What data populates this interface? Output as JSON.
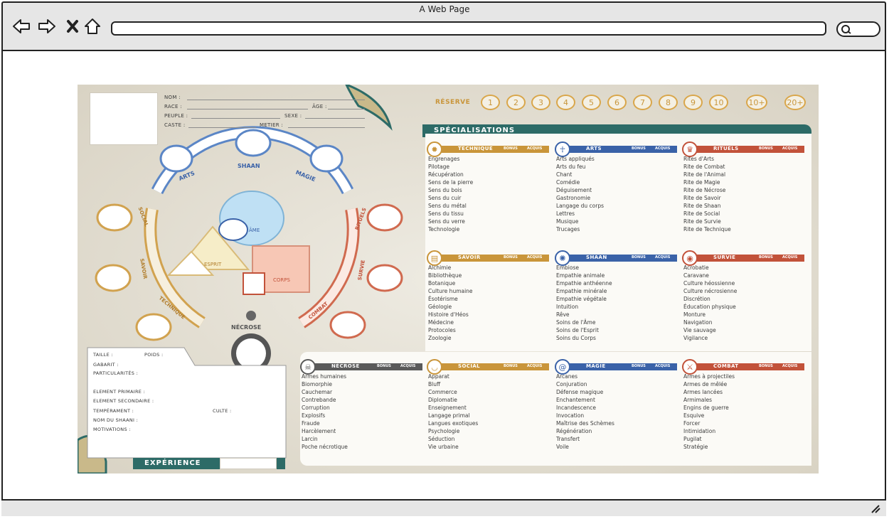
{
  "browser": {
    "title": "A Web Page",
    "back_icon": "arrow-left-icon",
    "forward_icon": "arrow-right-icon",
    "close_icon": "close-icon",
    "home_icon": "home-icon",
    "search_icon": "search-icon",
    "url": ""
  },
  "sheet": {
    "identity": {
      "nom": "NOM :",
      "race": "RACE :",
      "age": "ÂGE :",
      "peuple": "PEUPLE :",
      "sexe": "SEXE :",
      "caste": "CASTE :",
      "metier": "METIER :"
    },
    "wheel": {
      "top_labels": [
        "ARTS",
        "SHAAN",
        "MAGIE"
      ],
      "left_labels": [
        "SOCIAL",
        "SAVOIR",
        "TECHNIQUE"
      ],
      "right_labels": [
        "RITUELS",
        "SURVIE",
        "COMBAT"
      ],
      "ame": "ÂME",
      "esprit": "ESPRIT",
      "corps": "CORPS",
      "necrose": "NÉCROSE"
    },
    "reserve": {
      "label": "RÉSERVE",
      "values": [
        "1",
        "2",
        "3",
        "4",
        "5",
        "6",
        "7",
        "8",
        "9",
        "10",
        "10+",
        "20+"
      ]
    },
    "specialisations_title": "SPÉCIALISATIONS",
    "col_bonus": "BONUS",
    "col_acquis": "ACQUIS",
    "categories": [
      {
        "name": "TECHNIQUE",
        "color": "#c9953a",
        "icon": "gear-icon",
        "items": [
          "Engrenages",
          "Pilotage",
          "Récupération",
          "Sens de la pierre",
          "Sens du bois",
          "Sens du cuir",
          "Sens du métal",
          "Sens du tissu",
          "Sens du verre",
          "Technologie"
        ]
      },
      {
        "name": "ARTS",
        "color": "#3a62a8",
        "icon": "dancer-icon",
        "items": [
          "Arts appliqués",
          "Arts du feu",
          "Chant",
          "Comédie",
          "Déguisement",
          "Gastronomie",
          "Langage du corps",
          "Lettres",
          "Musique",
          "Trucages"
        ]
      },
      {
        "name": "RITUELS",
        "color": "#c2523a",
        "icon": "mask-icon",
        "items": [
          "Rites d'Arts",
          "Rite de Combat",
          "Rite de l'Animal",
          "Rite de Magie",
          "Rite de Nécrose",
          "Rite de Savoir",
          "Rite de Shaan",
          "Rite de Social",
          "Rite de Survie",
          "Rite de Technique"
        ]
      },
      {
        "name": "SAVOIR",
        "color": "#c9953a",
        "icon": "book-icon",
        "items": [
          "Alchimie",
          "Bibliothèque",
          "Botanique",
          "Culture humaine",
          "Ésotérisme",
          "Géologie",
          "Histoire d'Héos",
          "Médecine",
          "Protocoles",
          "Zoologie"
        ]
      },
      {
        "name": "SHAAN",
        "color": "#3a62a8",
        "icon": "shaan-icon",
        "items": [
          "Embiose",
          "Empathie animale",
          "Empathie anthéenne",
          "Empathie minérale",
          "Empathie végétale",
          "Intuition",
          "Rêve",
          "Soins de l'Âme",
          "Soins de l'Esprit",
          "Soins du Corps"
        ]
      },
      {
        "name": "SURVIE",
        "color": "#c2523a",
        "icon": "eye-icon",
        "items": [
          "Acrobatie",
          "Caravane",
          "Culture héossienne",
          "Culture nécrosienne",
          "Discrétion",
          "Éducation physique",
          "Monture",
          "Navigation",
          "Vie sauvage",
          "Vigilance"
        ]
      },
      {
        "name": "NÉCROSE",
        "color": "#5a5a5a",
        "icon": "skull-icon",
        "items": [
          "Armes humaines",
          "Biomorphie",
          "Cauchemar",
          "Contrebande",
          "Corruption",
          "Explosifs",
          "Fraude",
          "Harcèlement",
          "Larcin",
          "Poche nécrotique"
        ]
      },
      {
        "name": "SOCIAL",
        "color": "#c9953a",
        "icon": "lips-icon",
        "items": [
          "Apparat",
          "Bluff",
          "Commerce",
          "Diplomatie",
          "Enseignement",
          "Langage primal",
          "Langues exotiques",
          "Psychologie",
          "Séduction",
          "Vie urbaine"
        ]
      },
      {
        "name": "MAGIE",
        "color": "#3a62a8",
        "icon": "spiral-icon",
        "items": [
          "Arcanes",
          "Conjuration",
          "Défense magique",
          "Enchantement",
          "Incandescence",
          "Invocation",
          "Maîtrise des Schèmes",
          "Régénération",
          "Transfert",
          "Voile"
        ]
      },
      {
        "name": "COMBAT",
        "color": "#c2523a",
        "icon": "sword-icon",
        "items": [
          "Armes à projectiles",
          "Armes de mêlée",
          "Armes lancées",
          "Armimales",
          "Engins de guerre",
          "Esquive",
          "Forcer",
          "Intimidation",
          "Pugilat",
          "Stratégie"
        ]
      }
    ],
    "card": {
      "taille": "TAILLE :",
      "poids": "POIDS :",
      "gabarit": "GABARIT :",
      "particularites": "PARTICULARITÉS :",
      "element_primaire": "ELEMENT PRIMAIRE :",
      "element_secondaire": "ELEMENT SECONDAIRE :",
      "temperament": "TEMPÉRAMENT :",
      "culte": "CULTE :",
      "nom_shaani": "NOM DU SHAANI :",
      "motivations": "MOTIVATIONS :"
    },
    "experience": "EXPÉRIENCE"
  }
}
